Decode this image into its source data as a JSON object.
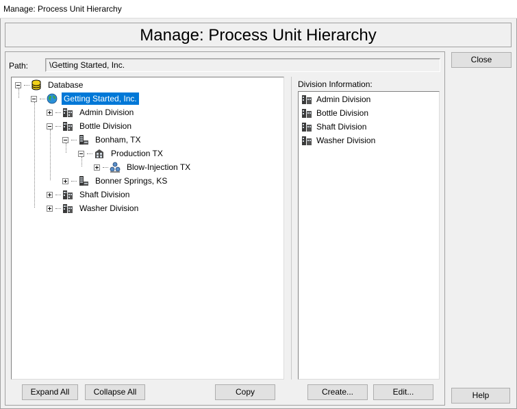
{
  "window": {
    "title": "Manage: Process Unit Hierarchy"
  },
  "header": {
    "title": "Manage: Process Unit Hierarchy"
  },
  "path": {
    "label": "Path:",
    "value": "\\Getting Started, Inc."
  },
  "tree": {
    "nodes": [
      {
        "label": "Database",
        "icon": "database-icon",
        "expander": "minus"
      },
      {
        "label": "Getting Started, Inc.",
        "icon": "globe-icon",
        "expander": "minus",
        "selected": true
      },
      {
        "label": "Admin Division",
        "icon": "division-icon",
        "expander": "plus"
      },
      {
        "label": "Bottle Division",
        "icon": "division-icon",
        "expander": "minus"
      },
      {
        "label": "Bonham, TX",
        "icon": "site-icon",
        "expander": "minus"
      },
      {
        "label": "Production TX",
        "icon": "area-icon",
        "expander": "minus"
      },
      {
        "label": "Blow-Injection TX",
        "icon": "process-unit-icon",
        "expander": "plus"
      },
      {
        "label": "Bonner Springs, KS",
        "icon": "site-icon",
        "expander": "plus"
      },
      {
        "label": "Shaft Division",
        "icon": "division-icon",
        "expander": "plus"
      },
      {
        "label": "Washer Division",
        "icon": "division-icon",
        "expander": "plus"
      }
    ]
  },
  "division_info": {
    "label": "Division Information:",
    "items": [
      "Admin Division",
      "Bottle Division",
      "Shaft Division",
      "Washer Division"
    ]
  },
  "buttons": {
    "close": "Close",
    "help": "Help",
    "expand_all": "Expand All",
    "collapse_all": "Collapse All",
    "copy": "Copy",
    "create": "Create...",
    "edit": "Edit..."
  },
  "colors": {
    "selection": "#0078d7",
    "background": "#f0f0f0"
  }
}
